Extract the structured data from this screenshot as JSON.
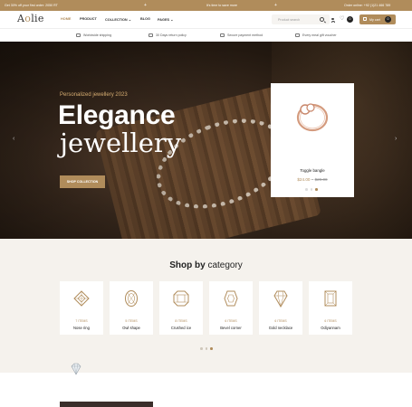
{
  "topbar": {
    "msg1": "Get 30% off your first order: 2050 RT",
    "msg2": "It's time to save more",
    "msg3": "Order online: +92 (1)21 466 789",
    "separator": "+"
  },
  "header": {
    "logo_pre": "A",
    "logo_o": "o",
    "logo_post": "lie",
    "nav": {
      "home": "HOME",
      "product": "PRODUCT",
      "collection": "COLLECTION",
      "blog": "BLOG",
      "pages": "PAGES"
    },
    "search_placeholder": "Product search",
    "wishlist_count": "0",
    "cart_label": "My cart",
    "cart_count": "0"
  },
  "features": [
    "Worldwide shipping",
    "30 Days return policy",
    "Secure payment method",
    "Every meal gift voucher"
  ],
  "hero": {
    "subtitle": "Personalized jewellery 2023",
    "title_line1": "Elegance",
    "title_line2": "jewellery",
    "button": "SHOP COLLECTION",
    "prev_arrow": "‹",
    "next_arrow": "›",
    "card": {
      "name": "Toggle bangle",
      "price_now": "$24.00",
      "price_sep": "–",
      "price_was": "$29.00",
      "dots_active_index": 2
    }
  },
  "category_section": {
    "title_bold": "Shop by",
    "title_rest": "category",
    "categories": [
      {
        "count": "7 ITEMS",
        "name": "Nose ring",
        "icon": "nose-ring-icon"
      },
      {
        "count": "5 ITEMS",
        "name": "Owl shape",
        "icon": "owl-shape-icon"
      },
      {
        "count": "8 ITEMS",
        "name": "Crushed ice",
        "icon": "crushed-ice-icon"
      },
      {
        "count": "6 ITEMS",
        "name": "Bevel corner",
        "icon": "bevel-corner-icon"
      },
      {
        "count": "6 ITEMS",
        "name": "Gold necklace",
        "icon": "gold-necklace-icon"
      },
      {
        "count": "6 ITEMS",
        "name": "Odiyannam",
        "icon": "odiyannam-icon"
      }
    ],
    "dots_active_index": 2
  },
  "colors": {
    "accent": "#b08c5b",
    "dark": "#222222",
    "section_bg": "#f5f2ed"
  }
}
